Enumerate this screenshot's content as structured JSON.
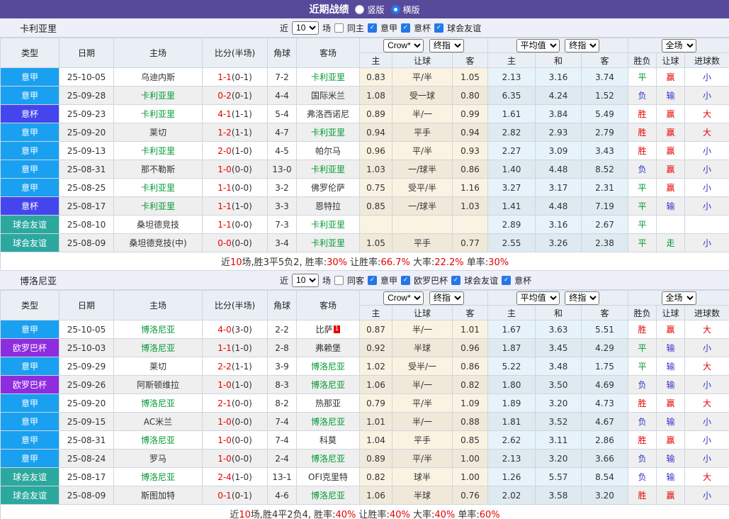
{
  "topbar": {
    "title": "近期战绩",
    "vertical_label": "竖版",
    "horizontal_label": "横版"
  },
  "table_header": {
    "left_cols": [
      "类型",
      "日期",
      "主场",
      "比分(半场)",
      "角球",
      "客场"
    ],
    "sub_cols": [
      "主",
      "让球",
      "客",
      "主",
      "和",
      "客",
      "胜负",
      "让球",
      "进球数"
    ],
    "selects": {
      "odds_provider": "Crow*",
      "odds_stage": "终指",
      "average": "平均值",
      "avg_stage": "终指",
      "scope": "全场"
    }
  },
  "league_colors": {
    "意甲": "#19a0f0",
    "意杯": "#4545ee",
    "球会友谊": "#2ca89f",
    "欧罗巴杯": "#8e2ce0"
  },
  "result_colors": {
    "胜": "#e60000",
    "平": "#009933",
    "负": "#3333cc",
    "赢": "#e60000",
    "输": "#3333cc",
    "走": "#009933",
    "大": "#e60000",
    "小": "#3333cc"
  },
  "sections": [
    {
      "team": "卡利亚里",
      "filter": {
        "near": "近",
        "count": "10",
        "unit": "场",
        "same": {
          "label": "同主",
          "checked": false
        },
        "leagues": [
          {
            "label": "意甲",
            "checked": true
          },
          {
            "label": "意杯",
            "checked": true
          },
          {
            "label": "球会友谊",
            "checked": true
          }
        ]
      },
      "rows": [
        {
          "lg": "意甲",
          "date": "25-10-05",
          "home": "乌迪内斯",
          "hg": false,
          "ft": "1-1",
          "ht": "0-1",
          "cn": "7-2",
          "away": "卡利亚里",
          "ag": true,
          "rc": "",
          "o": [
            "0.83",
            "平/半",
            "1.05"
          ],
          "a": [
            "2.13",
            "3.16",
            "3.74"
          ],
          "r": [
            "平",
            "赢",
            "小"
          ]
        },
        {
          "lg": "意甲",
          "date": "25-09-28",
          "home": "卡利亚里",
          "hg": true,
          "ft": "0-2",
          "ht": "0-1",
          "cn": "4-4",
          "away": "国际米兰",
          "ag": false,
          "rc": "",
          "o": [
            "1.08",
            "受一球",
            "0.80"
          ],
          "a": [
            "6.35",
            "4.24",
            "1.52"
          ],
          "r": [
            "负",
            "输",
            "小"
          ]
        },
        {
          "lg": "意杯",
          "date": "25-09-23",
          "home": "卡利亚里",
          "hg": true,
          "ft": "4-1",
          "ht": "1-1",
          "cn": "5-4",
          "away": "弗洛西诺尼",
          "ag": false,
          "rc": "",
          "o": [
            "0.89",
            "半/一",
            "0.99"
          ],
          "a": [
            "1.61",
            "3.84",
            "5.49"
          ],
          "r": [
            "胜",
            "赢",
            "大"
          ]
        },
        {
          "lg": "意甲",
          "date": "25-09-20",
          "home": "莱切",
          "hg": false,
          "ft": "1-2",
          "ht": "1-1",
          "cn": "4-7",
          "away": "卡利亚里",
          "ag": true,
          "rc": "",
          "o": [
            "0.94",
            "平手",
            "0.94"
          ],
          "a": [
            "2.82",
            "2.93",
            "2.79"
          ],
          "r": [
            "胜",
            "赢",
            "大"
          ]
        },
        {
          "lg": "意甲",
          "date": "25-09-13",
          "home": "卡利亚里",
          "hg": true,
          "ft": "2-0",
          "ht": "1-0",
          "cn": "4-5",
          "away": "帕尔马",
          "ag": false,
          "rc": "",
          "o": [
            "0.96",
            "平/半",
            "0.93"
          ],
          "a": [
            "2.27",
            "3.09",
            "3.43"
          ],
          "r": [
            "胜",
            "赢",
            "小"
          ]
        },
        {
          "lg": "意甲",
          "date": "25-08-31",
          "home": "那不勒斯",
          "hg": false,
          "ft": "1-0",
          "ht": "0-0",
          "cn": "13-0",
          "away": "卡利亚里",
          "ag": true,
          "rc": "",
          "o": [
            "1.03",
            "一/球半",
            "0.86"
          ],
          "a": [
            "1.40",
            "4.48",
            "8.52"
          ],
          "r": [
            "负",
            "赢",
            "小"
          ]
        },
        {
          "lg": "意甲",
          "date": "25-08-25",
          "home": "卡利亚里",
          "hg": true,
          "ft": "1-1",
          "ht": "0-0",
          "cn": "3-2",
          "away": "佛罗伦萨",
          "ag": false,
          "rc": "",
          "o": [
            "0.75",
            "受平/半",
            "1.16"
          ],
          "a": [
            "3.27",
            "3.17",
            "2.31"
          ],
          "r": [
            "平",
            "赢",
            "小"
          ]
        },
        {
          "lg": "意杯",
          "date": "25-08-17",
          "home": "卡利亚里",
          "hg": true,
          "ft": "1-1",
          "ht": "1-0",
          "cn": "3-3",
          "away": "恩特拉",
          "ag": false,
          "rc": "",
          "o": [
            "0.85",
            "一/球半",
            "1.03"
          ],
          "a": [
            "1.41",
            "4.48",
            "7.19"
          ],
          "r": [
            "平",
            "输",
            "小"
          ]
        },
        {
          "lg": "球会友谊",
          "date": "25-08-10",
          "home": "桑坦德竞技",
          "hg": false,
          "ft": "1-1",
          "ht": "0-0",
          "cn": "7-3",
          "away": "卡利亚里",
          "ag": true,
          "rc": "",
          "o": [
            "",
            "",
            ""
          ],
          "a": [
            "2.89",
            "3.16",
            "2.67"
          ],
          "r": [
            "平",
            "",
            ""
          ]
        },
        {
          "lg": "球会友谊",
          "date": "25-08-09",
          "home": "桑坦德竞技(中)",
          "hg": false,
          "ft": "0-0",
          "ht": "0-0",
          "cn": "3-4",
          "away": "卡利亚里",
          "ag": true,
          "rc": "",
          "o": [
            "1.05",
            "平手",
            "0.77"
          ],
          "a": [
            "2.55",
            "3.26",
            "2.38"
          ],
          "r": [
            "平",
            "走",
            "小"
          ]
        }
      ],
      "summary": [
        [
          "近",
          0
        ],
        [
          "10",
          1
        ],
        [
          "场,胜3平5负2, 胜率:",
          0
        ],
        [
          "30%",
          1
        ],
        [
          " 让胜率:",
          0
        ],
        [
          "66.7%",
          1
        ],
        [
          " 大率:",
          0
        ],
        [
          "22.2%",
          1
        ],
        [
          " 单率:",
          0
        ],
        [
          "30%",
          1
        ]
      ]
    },
    {
      "team": "博洛尼亚",
      "filter": {
        "near": "近",
        "count": "10",
        "unit": "场",
        "same": {
          "label": "同客",
          "checked": false
        },
        "leagues": [
          {
            "label": "意甲",
            "checked": true
          },
          {
            "label": "欧罗巴杯",
            "checked": true
          },
          {
            "label": "球会友谊",
            "checked": true
          },
          {
            "label": "意杯",
            "checked": true
          }
        ]
      },
      "rows": [
        {
          "lg": "意甲",
          "date": "25-10-05",
          "home": "博洛尼亚",
          "hg": true,
          "ft": "4-0",
          "ht": "3-0",
          "cn": "2-2",
          "away": "比萨",
          "ag": false,
          "rc": "1",
          "o": [
            "0.87",
            "半/一",
            "1.01"
          ],
          "a": [
            "1.67",
            "3.63",
            "5.51"
          ],
          "r": [
            "胜",
            "赢",
            "大"
          ]
        },
        {
          "lg": "欧罗巴杯",
          "date": "25-10-03",
          "home": "博洛尼亚",
          "hg": true,
          "ft": "1-1",
          "ht": "1-0",
          "cn": "2-8",
          "away": "弗赖堡",
          "ag": false,
          "rc": "",
          "o": [
            "0.92",
            "半球",
            "0.96"
          ],
          "a": [
            "1.87",
            "3.45",
            "4.29"
          ],
          "r": [
            "平",
            "输",
            "小"
          ]
        },
        {
          "lg": "意甲",
          "date": "25-09-29",
          "home": "莱切",
          "hg": false,
          "ft": "2-2",
          "ht": "1-1",
          "cn": "3-9",
          "away": "博洛尼亚",
          "ag": true,
          "rc": "",
          "o": [
            "1.02",
            "受半/一",
            "0.86"
          ],
          "a": [
            "5.22",
            "3.48",
            "1.75"
          ],
          "r": [
            "平",
            "输",
            "大"
          ]
        },
        {
          "lg": "欧罗巴杯",
          "date": "25-09-26",
          "home": "阿斯顿维拉",
          "hg": false,
          "ft": "1-0",
          "ht": "1-0",
          "cn": "8-3",
          "away": "博洛尼亚",
          "ag": true,
          "rc": "",
          "o": [
            "1.06",
            "半/一",
            "0.82"
          ],
          "a": [
            "1.80",
            "3.50",
            "4.69"
          ],
          "r": [
            "负",
            "输",
            "小"
          ]
        },
        {
          "lg": "意甲",
          "date": "25-09-20",
          "home": "博洛尼亚",
          "hg": true,
          "ft": "2-1",
          "ht": "0-0",
          "cn": "8-2",
          "away": "热那亚",
          "ag": false,
          "rc": "",
          "o": [
            "0.79",
            "平/半",
            "1.09"
          ],
          "a": [
            "1.89",
            "3.20",
            "4.73"
          ],
          "r": [
            "胜",
            "赢",
            "大"
          ]
        },
        {
          "lg": "意甲",
          "date": "25-09-15",
          "home": "AC米兰",
          "hg": false,
          "ft": "1-0",
          "ht": "0-0",
          "cn": "7-4",
          "away": "博洛尼亚",
          "ag": true,
          "rc": "",
          "o": [
            "1.01",
            "半/一",
            "0.88"
          ],
          "a": [
            "1.81",
            "3.52",
            "4.67"
          ],
          "r": [
            "负",
            "输",
            "小"
          ]
        },
        {
          "lg": "意甲",
          "date": "25-08-31",
          "home": "博洛尼亚",
          "hg": true,
          "ft": "1-0",
          "ht": "0-0",
          "cn": "7-4",
          "away": "科莫",
          "ag": false,
          "rc": "",
          "o": [
            "1.04",
            "平手",
            "0.85"
          ],
          "a": [
            "2.62",
            "3.11",
            "2.86"
          ],
          "r": [
            "胜",
            "赢",
            "小"
          ]
        },
        {
          "lg": "意甲",
          "date": "25-08-24",
          "home": "罗马",
          "hg": false,
          "ft": "1-0",
          "ht": "0-0",
          "cn": "2-4",
          "away": "博洛尼亚",
          "ag": true,
          "rc": "",
          "o": [
            "0.89",
            "平/半",
            "1.00"
          ],
          "a": [
            "2.13",
            "3.20",
            "3.66"
          ],
          "r": [
            "负",
            "输",
            "小"
          ]
        },
        {
          "lg": "球会友谊",
          "date": "25-08-17",
          "home": "博洛尼亚",
          "hg": true,
          "ft": "2-4",
          "ht": "1-0",
          "cn": "13-1",
          "away": "OFI克里特",
          "ag": false,
          "rc": "",
          "o": [
            "0.82",
            "球半",
            "1.00"
          ],
          "a": [
            "1.26",
            "5.57",
            "8.54"
          ],
          "r": [
            "负",
            "输",
            "大"
          ]
        },
        {
          "lg": "球会友谊",
          "date": "25-08-09",
          "home": "斯图加特",
          "hg": false,
          "ft": "0-1",
          "ht": "0-1",
          "cn": "4-6",
          "away": "博洛尼亚",
          "ag": true,
          "rc": "",
          "o": [
            "1.06",
            "半球",
            "0.76"
          ],
          "a": [
            "2.02",
            "3.58",
            "3.20"
          ],
          "r": [
            "胜",
            "赢",
            "小"
          ]
        }
      ],
      "summary": [
        [
          "近",
          0
        ],
        [
          "10",
          1
        ],
        [
          "场,胜4平2负4, 胜率:",
          0
        ],
        [
          "40%",
          1
        ],
        [
          " 让胜率:",
          0
        ],
        [
          "40%",
          1
        ],
        [
          " 大率:",
          0
        ],
        [
          "40%",
          1
        ],
        [
          " 单率:",
          0
        ],
        [
          "60%",
          1
        ]
      ]
    }
  ]
}
